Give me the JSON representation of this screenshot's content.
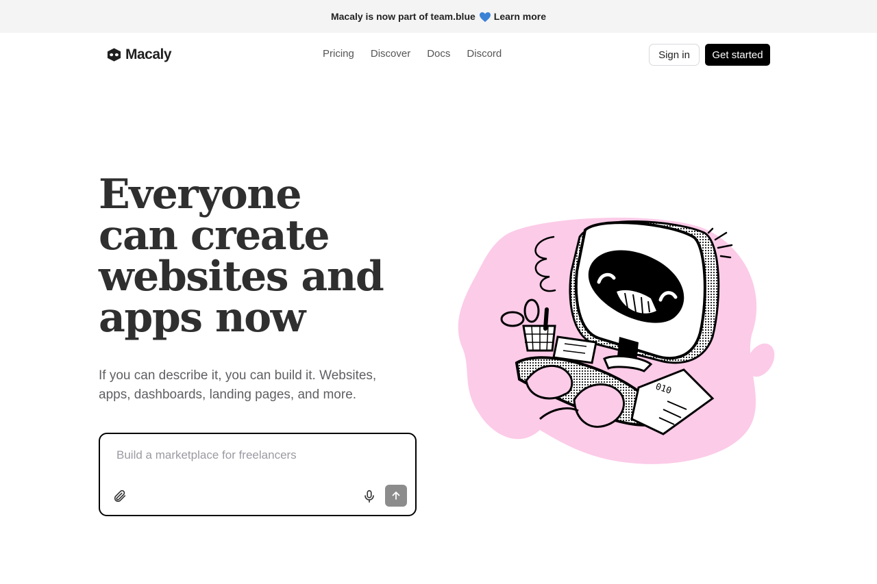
{
  "announcement": {
    "text": "Macaly is now part of team.blue",
    "heart_icon": "blue-heart-icon",
    "link": "Learn more"
  },
  "nav": {
    "logo_text": "Macaly",
    "logo_icon": "macaly-logo-icon",
    "links": [
      "Pricing",
      "Discover",
      "Docs",
      "Discord"
    ],
    "sign_in": "Sign in",
    "get_started": "Get started"
  },
  "hero": {
    "headline_lines": [
      "Everyone",
      "can create",
      "websites and",
      "apps now"
    ],
    "subtext": "If you can describe it, you can build it. Websites, apps, dashboards, landing pages, and more."
  },
  "prompt": {
    "placeholder": "Build a marketplace for freelancers",
    "value": "",
    "attach_icon": "paperclip-icon",
    "mic_icon": "microphone-icon",
    "send_icon": "arrow-up-icon"
  },
  "colors": {
    "accent": "#000000",
    "illustration_bg": "#fccbe8",
    "announcement_bg": "#f4f4f5",
    "send_button": "#8c8c8c"
  }
}
